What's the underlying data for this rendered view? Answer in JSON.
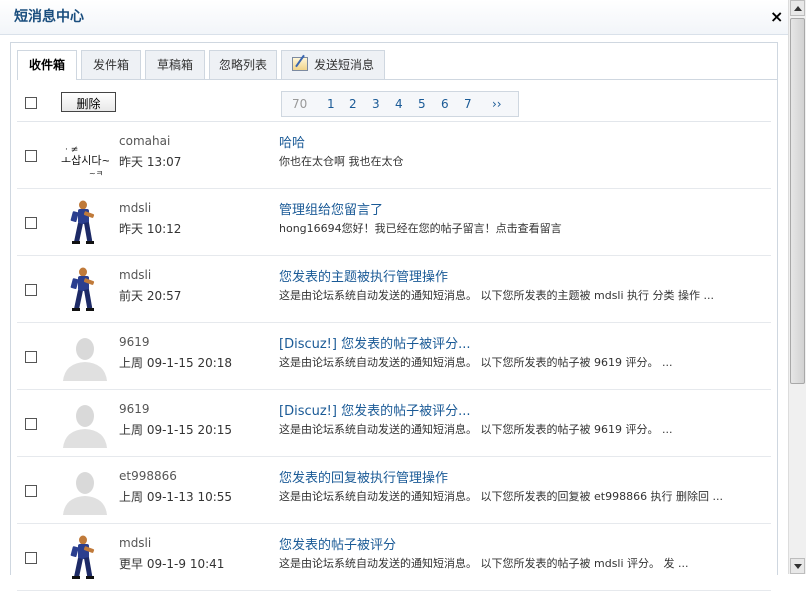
{
  "window": {
    "title": "短消息中心",
    "close_glyph": "×"
  },
  "tabs": [
    {
      "label": "收件箱",
      "active": true
    },
    {
      "label": "发件箱"
    },
    {
      "label": "草稿箱"
    },
    {
      "label": "忽略列表"
    },
    {
      "label": "发送短消息",
      "icon": "compose-icon"
    }
  ],
  "toolbar": {
    "delete_label": "删除"
  },
  "pager": {
    "total": "70",
    "pages": [
      "1",
      "2",
      "3",
      "4",
      "5",
      "6",
      "7"
    ],
    "next": "››"
  },
  "messages": [
    {
      "user": "comahai",
      "time": "昨天  13:07",
      "subject": "哈哈",
      "preview": "你也在太仓啊  我也在太仓",
      "avatar": "handwriting-avatar"
    },
    {
      "user": "mdsli",
      "time": "昨天  10:12",
      "subject": "管理组给您留言了",
      "preview": "hong16694您好！我已经在您的帖子留言！点击查看留言",
      "avatar": "figure-avatar"
    },
    {
      "user": "mdsli",
      "time": "前天  20:57",
      "subject": "您发表的主题被执行管理操作",
      "preview": "这是由论坛系统自动发送的通知短消息。 以下您所发表的主题被 mdsli 执行 分类 操作 ...",
      "avatar": "figure-avatar"
    },
    {
      "user": "9619",
      "time": "上周  09-1-15 20:18",
      "subject": "[Discuz!] 您发表的帖子被评分...",
      "preview": "这是由论坛系统自动发送的通知短消息。 以下您所发表的帖子被 9619 评分。 ...",
      "avatar": "default-avatar"
    },
    {
      "user": "9619",
      "time": "上周  09-1-15 20:15",
      "subject": "[Discuz!] 您发表的帖子被评分...",
      "preview": "这是由论坛系统自动发送的通知短消息。 以下您所发表的帖子被 9619 评分。 ...",
      "avatar": "default-avatar"
    },
    {
      "user": "et998866",
      "time": "上周  09-1-13 10:55",
      "subject": "您发表的回复被执行管理操作",
      "preview": "这是由论坛系统自动发送的通知短消息。 以下您所发表的回复被 et998866 执行 删除回 ...",
      "avatar": "default-avatar"
    },
    {
      "user": "mdsli",
      "time": "更早  09-1-9 10:41",
      "subject": "您发表的帖子被评分",
      "preview": "这是由论坛系统自动发送的通知短消息。 以下您所发表的帖子被 mdsli 评分。 发 ...",
      "avatar": "figure-avatar"
    }
  ]
}
